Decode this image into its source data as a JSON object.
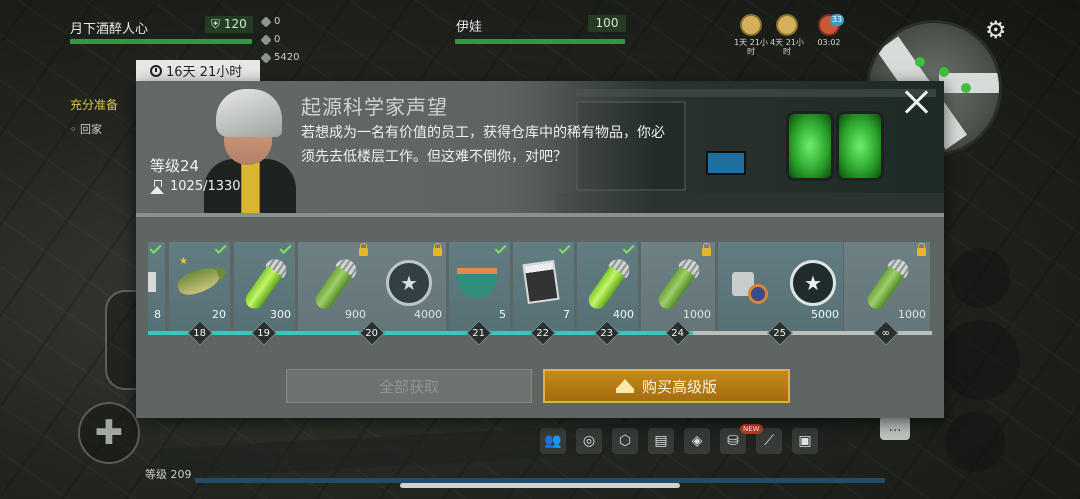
{
  "hud": {
    "player1_name": "月下酒醉人心",
    "player1_badge": "120",
    "stats": [
      "0",
      "0",
      "5420"
    ],
    "player2_name": "伊娃",
    "player2_badge": "100",
    "timers": [
      {
        "label": "1天 21小时",
        "icon": "crate-icon"
      },
      {
        "label": "4天 21小时",
        "icon": "coin-icon"
      },
      {
        "label": "03:02",
        "icon": "gear-event-icon"
      }
    ],
    "notif_count": "33"
  },
  "left_panel": {
    "heading": "充分准备",
    "item": "回家"
  },
  "bottom": {
    "level_label": "等级 209",
    "new_badge": "NEW"
  },
  "modal": {
    "timer": "16天 21小时",
    "title": "起源科学家声望",
    "description": "若想成为一名有价值的员工，获得仓库中的稀有物品，你必须先去低楼层工作。但这难不倒你，对吧？",
    "level": "等级24",
    "xp": "1025/1330",
    "buttons": {
      "claim_all": "全部获取",
      "buy_premium": "购买高级版"
    },
    "rewards": [
      {
        "item": "unknown-item",
        "amount": "8",
        "claimed": true,
        "locked": false
      },
      {
        "item": "pike-fish",
        "amount": "20",
        "claimed": true,
        "locked": false
      },
      {
        "item": "green-serum",
        "amount": "300",
        "claimed": true,
        "locked": false
      },
      {
        "item": "green-serum",
        "amount": "900",
        "claimed": false,
        "locked": true
      },
      {
        "item": "star-badge",
        "amount": "4000",
        "claimed": false,
        "locked": true
      },
      {
        "item": "food-bowl",
        "amount": "5",
        "claimed": true,
        "locked": false
      },
      {
        "item": "magazine",
        "amount": "7",
        "claimed": true,
        "locked": false
      },
      {
        "item": "green-serum",
        "amount": "400",
        "claimed": true,
        "locked": false
      },
      {
        "item": "green-serum",
        "amount": "1000",
        "claimed": false,
        "locked": true
      },
      {
        "item": "parts",
        "amount": "",
        "claimed": false,
        "locked": false
      },
      {
        "item": "star-badge",
        "amount": "5000",
        "claimed": false,
        "locked": false
      },
      {
        "item": "green-serum",
        "amount": "1000",
        "claimed": false,
        "locked": true
      }
    ],
    "levels": [
      "18",
      "19",
      "20",
      "21",
      "22",
      "23",
      "24",
      "25",
      "∞"
    ],
    "progress_fraction": 0.695
  }
}
